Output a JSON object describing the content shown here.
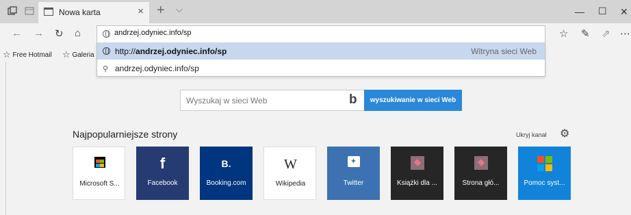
{
  "tab": {
    "title": "Nowa karta"
  },
  "address_bar": {
    "value": "andrzej.odyniec.info/sp"
  },
  "favorites": [
    {
      "label": "Free Hotmail"
    },
    {
      "label": "Galeria"
    }
  ],
  "suggestions": {
    "first": {
      "prefix": "http://",
      "bold": "andrzej.odyniec.info/sp",
      "label": "Witryna sieci Web"
    },
    "second": {
      "text": "andrzej.odyniec.info/sp"
    }
  },
  "search": {
    "placeholder": "Wyszukaj w sieci Web",
    "button": "wyszukiwanie w sieci Web"
  },
  "top_sites": {
    "title": "Najpopularniejsze strony",
    "hide_feed": "Ukryj kanał",
    "tiles": [
      {
        "label": "Microsoft S...",
        "icon": "store-bag-icon"
      },
      {
        "label": "Facebook",
        "icon": "facebook-icon"
      },
      {
        "label": "Booking.com",
        "icon": "booking-icon"
      },
      {
        "label": "Wikipedia",
        "icon": "wikipedia-icon"
      },
      {
        "label": "Twitter",
        "icon": "twitter-icon"
      },
      {
        "label": "Książki dla ...",
        "icon": "pink-site-icon"
      },
      {
        "label": "Strona głó...",
        "icon": "pink-site-icon"
      },
      {
        "label": "Pomoc syst...",
        "icon": "microsoft-logo-icon"
      }
    ]
  },
  "colors": {
    "accent": "#2b88d8",
    "suggestion_highlight": "#c7d8ee",
    "facebook": "#273b73",
    "booking": "#003580",
    "twitter": "#3c72b1",
    "dark_tile": "#262626",
    "help_tile": "#1183d9"
  }
}
